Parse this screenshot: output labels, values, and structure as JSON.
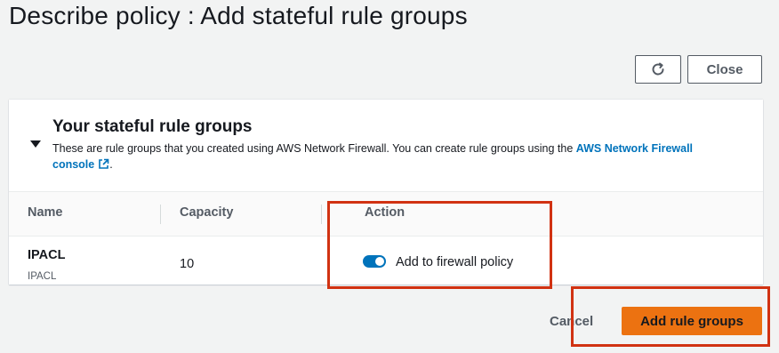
{
  "page": {
    "title": "Describe policy : Add stateful rule groups"
  },
  "header_actions": {
    "refresh_icon": "refresh-icon",
    "close_label": "Close"
  },
  "section": {
    "title": "Your stateful rule groups",
    "description_before": "These are rule groups that you created using AWS Network Firewall. You can create rule groups using the ",
    "link_text": "AWS Network Firewall console",
    "description_after": ".",
    "link_icon": "external-link-icon"
  },
  "table": {
    "columns": [
      "Name",
      "Capacity",
      "Action"
    ],
    "rows": [
      {
        "name": "IPACL",
        "subname": "IPACL",
        "capacity": "10",
        "action_label": "Add to firewall policy",
        "action_enabled": true
      }
    ]
  },
  "footer": {
    "cancel_label": "Cancel",
    "primary_label": "Add rule groups"
  },
  "colors": {
    "primary": "#ec7211",
    "link": "#0073bb",
    "toggle_on": "#0073bb",
    "highlight": "#d13212"
  }
}
